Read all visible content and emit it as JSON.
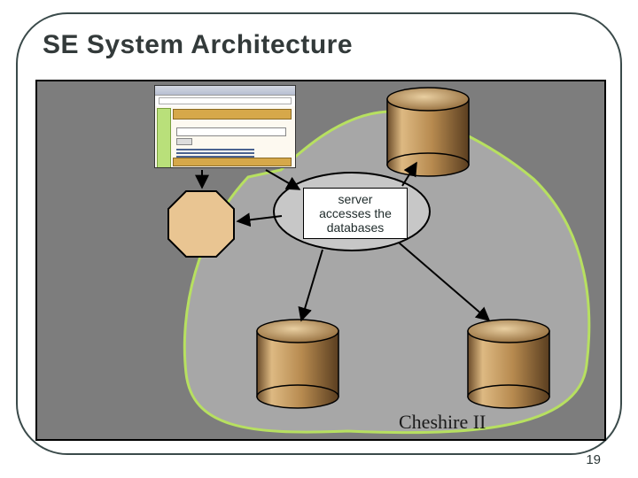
{
  "title": "SE System Architecture",
  "page_number": "19",
  "server_label": {
    "line1": "server",
    "line2": "accesses the",
    "line3": "databases"
  },
  "region_label": "Cheshire II",
  "chart_data": {
    "type": "diagram",
    "title": "SE System Architecture",
    "nodes": [
      {
        "id": "client",
        "label": "browser / client UI",
        "shape": "window"
      },
      {
        "id": "node_octagon",
        "label": "",
        "shape": "octagon"
      },
      {
        "id": "server",
        "label": "server accesses the databases",
        "shape": "ellipse"
      },
      {
        "id": "db_top",
        "label": "",
        "shape": "cylinder"
      },
      {
        "id": "db_left",
        "label": "",
        "shape": "cylinder"
      },
      {
        "id": "db_right",
        "label": "",
        "shape": "cylinder"
      }
    ],
    "edges": [
      {
        "from": "client",
        "to": "node_octagon",
        "directed": true
      },
      {
        "from": "client",
        "to": "server",
        "directed": true
      },
      {
        "from": "server",
        "to": "node_octagon",
        "directed": true
      },
      {
        "from": "server",
        "to": "db_top",
        "directed": true
      },
      {
        "from": "server",
        "to": "db_left",
        "directed": true
      },
      {
        "from": "server",
        "to": "db_right",
        "directed": true
      }
    ],
    "regions": [
      {
        "label": "Cheshire II",
        "contains": [
          "server",
          "db_top",
          "db_left",
          "db_right"
        ]
      }
    ]
  }
}
